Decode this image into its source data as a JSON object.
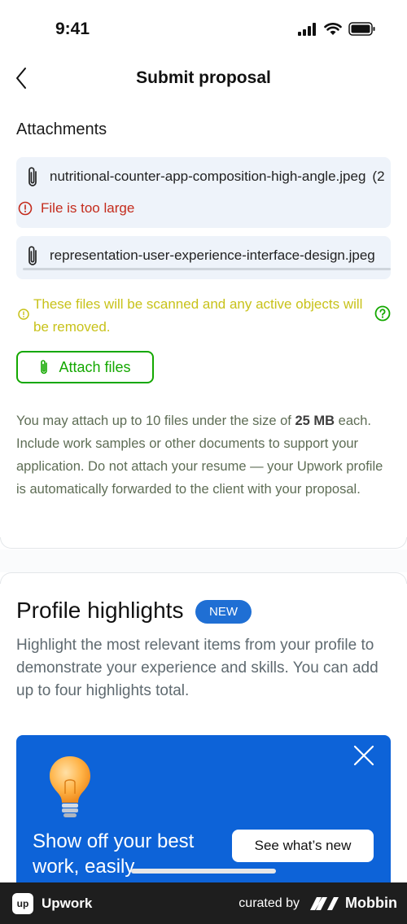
{
  "status": {
    "time": "9:41"
  },
  "header": {
    "title": "Submit proposal"
  },
  "attachments": {
    "section_title": "Attachments",
    "files": [
      {
        "name": "nutritional-counter-app-composition-high-angle.jpeg",
        "overflow": "(2",
        "error": "File is too large"
      },
      {
        "name": "representation-user-experience-interface-design.jpeg"
      }
    ],
    "notice": "These files will be scanned and any active objects will be removed.",
    "attach_label": "Attach files",
    "help_before": "You may attach up to 10 files under the size of ",
    "help_size": "25 MB",
    "help_after": " each. Include work samples or other documents to support your application. Do not attach your resume — your Upwork profile is automatically forwarded to the client with your proposal."
  },
  "profile_highlights": {
    "title": "Profile highlights",
    "badge": "NEW",
    "description": "Highlight the most relevant items from your profile to demonstrate your experience and skills. You can add up to four highlights total.",
    "promo": {
      "heading": "Show off your best work, easily",
      "cta": "See what’s new"
    }
  },
  "footer": {
    "brand": "Upwork",
    "logo_text": "up",
    "curated_by": "curated by",
    "curator": "Mobbin"
  },
  "colors": {
    "accent_green": "#14a800",
    "error_red": "#c42b1c",
    "warning_yellow": "#c8c21a",
    "promo_blue": "#0d63d8",
    "badge_blue": "#1f6fd4"
  },
  "icons": [
    "signal-icon",
    "wifi-icon",
    "battery-icon",
    "back-arrow-icon",
    "paperclip-icon",
    "error-icon",
    "info-icon",
    "help-icon",
    "close-icon",
    "lightbulb-icon",
    "mobbin-logo-icon"
  ]
}
